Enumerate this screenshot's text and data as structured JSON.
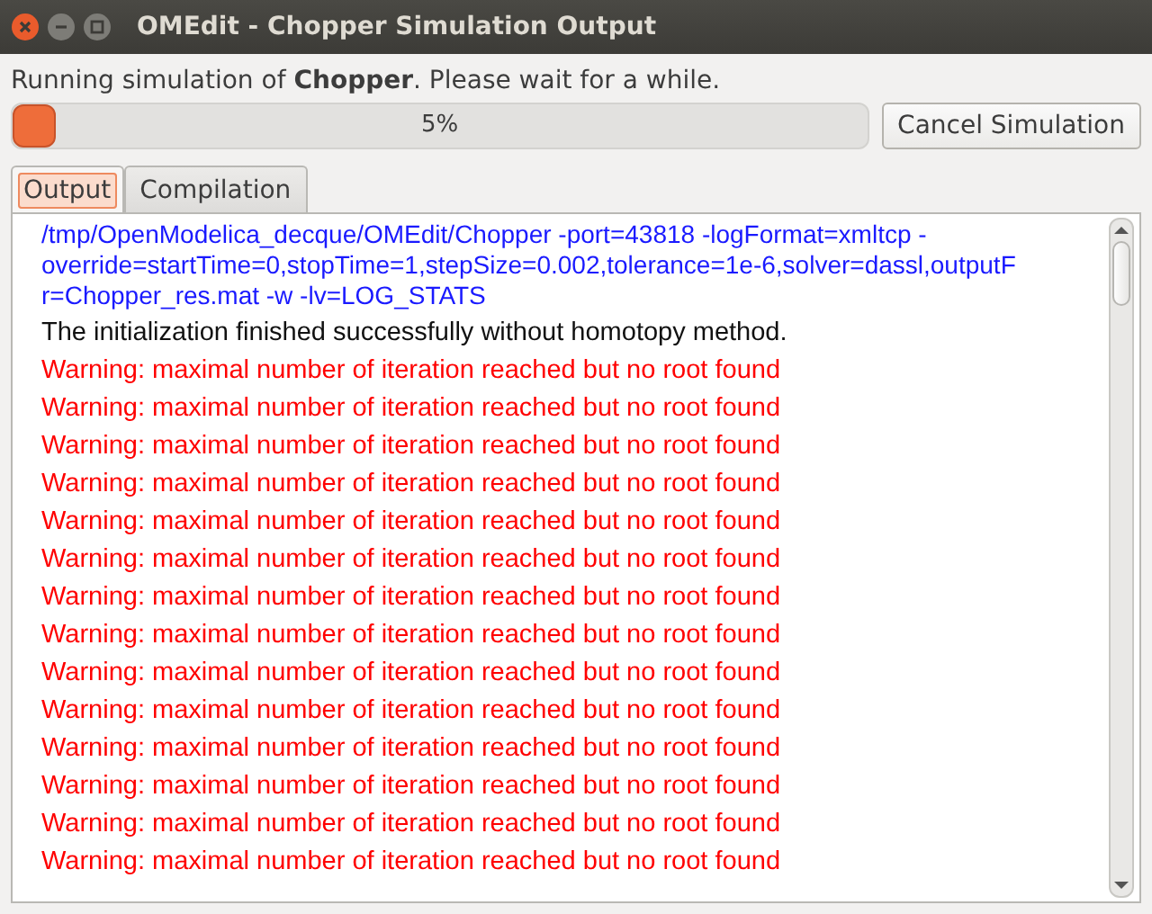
{
  "window": {
    "title": "OMEdit - Chopper Simulation Output"
  },
  "status": "Running simulation of **Chopper**. Please wait for a while.",
  "progress": {
    "level": 0.05,
    "reading": "5%"
  },
  "cancel_button": "Cancel Simulation",
  "tabs": [
    {
      "label": "Output",
      "selected": true
    },
    {
      "label": "Compilation",
      "selected": false
    }
  ],
  "output": {
    "lines": [
      {
        "kind": "command",
        "text": "/tmp/OpenModelica_decque/OMEdit/Chopper -port=43818 -logFormat=xmltcp -"
      },
      {
        "kind": "command",
        "text": "override=startTime=0,stopTime=1,stepSize=0.002,tolerance=1e-6,solver=dassl,outputF"
      },
      {
        "kind": "command",
        "text": "r=Chopper_res.mat -w -lv=LOG_STATS"
      },
      {
        "kind": "info",
        "text": "The initialization finished successfully without homotopy method."
      },
      {
        "kind": "warning",
        "text": "Warning: maximal number of iteration reached but no root found"
      },
      {
        "kind": "warning",
        "text": "Warning: maximal number of iteration reached but no root found"
      },
      {
        "kind": "warning",
        "text": "Warning: maximal number of iteration reached but no root found"
      },
      {
        "kind": "warning",
        "text": "Warning: maximal number of iteration reached but no root found"
      },
      {
        "kind": "warning",
        "text": "Warning: maximal number of iteration reached but no root found"
      },
      {
        "kind": "warning",
        "text": "Warning: maximal number of iteration reached but no root found"
      },
      {
        "kind": "warning",
        "text": "Warning: maximal number of iteration reached but no root found"
      },
      {
        "kind": "warning",
        "text": "Warning: maximal number of iteration reached but no root found"
      },
      {
        "kind": "warning",
        "text": "Warning: maximal number of iteration reached but no root found"
      },
      {
        "kind": "warning",
        "text": "Warning: maximal number of iteration reached but no root found"
      },
      {
        "kind": "warning",
        "text": "Warning: maximal number of iteration reached but no root found"
      },
      {
        "kind": "warning",
        "text": "Warning: maximal number of iteration reached but no root found"
      },
      {
        "kind": "warning",
        "text": "Warning: maximal number of iteration reached but no root found"
      },
      {
        "kind": "warning",
        "text": "Warning: maximal number of iteration reached but no root found"
      }
    ]
  }
}
